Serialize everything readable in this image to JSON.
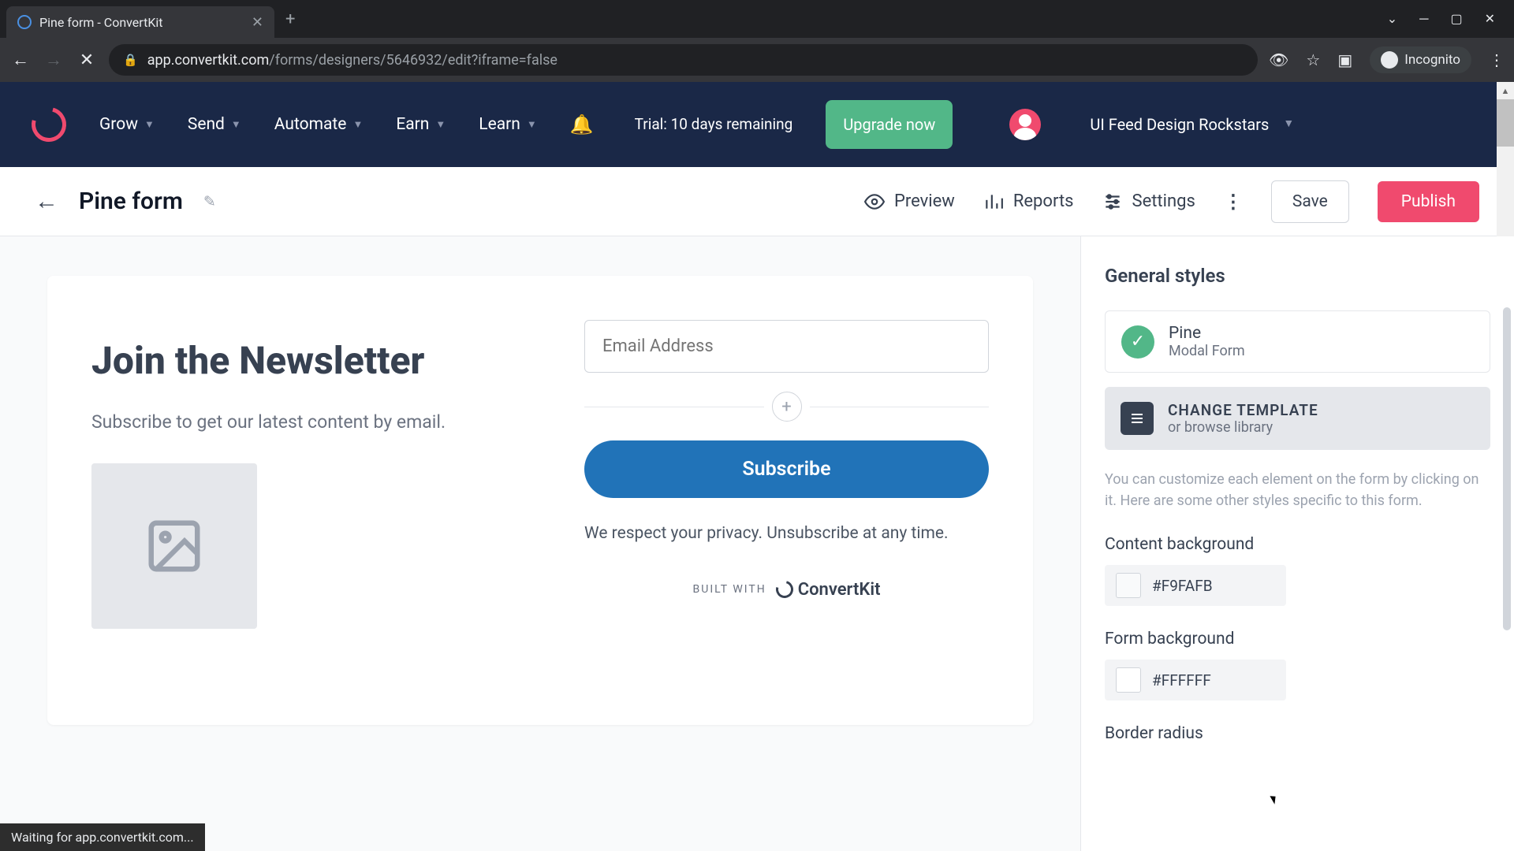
{
  "browser": {
    "tab_title": "Pine form - ConvertKit",
    "url_domain": "app.convertkit.com",
    "url_path": "/forms/designers/5646932/edit?iframe=false",
    "incognito": "Incognito",
    "status": "Waiting for app.convertkit.com..."
  },
  "topnav": {
    "items": [
      "Grow",
      "Send",
      "Automate",
      "Earn",
      "Learn"
    ],
    "trial": "Trial: 10 days remaining",
    "upgrade": "Upgrade now",
    "account": "UI Feed Design Rockstars"
  },
  "subnav": {
    "form_name": "Pine form",
    "preview": "Preview",
    "reports": "Reports",
    "settings": "Settings",
    "save": "Save",
    "publish": "Publish"
  },
  "form": {
    "title": "Join the Newsletter",
    "subtitle": "Subscribe to get our latest content by email.",
    "email_placeholder": "Email Address",
    "subscribe": "Subscribe",
    "privacy": "We respect your privacy. Unsubscribe at any time.",
    "built_with": "BUILT WITH",
    "brand": "ConvertKit"
  },
  "panel": {
    "title": "General styles",
    "template_name": "Pine",
    "template_type": "Modal Form",
    "change_template": "CHANGE TEMPLATE",
    "browse": "or browse library",
    "help": "You can customize each element on the form by clicking on it. Here are some other styles specific to this form.",
    "content_bg_label": "Content background",
    "content_bg_value": "#F9FAFB",
    "form_bg_label": "Form background",
    "form_bg_value": "#FFFFFF",
    "border_radius_label": "Border radius"
  }
}
